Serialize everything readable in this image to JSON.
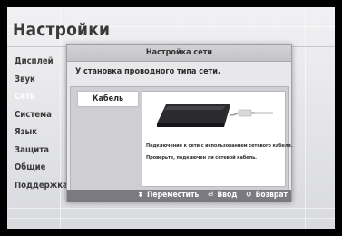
{
  "page": {
    "title": "Настройки"
  },
  "menu": {
    "items": [
      {
        "label": "Дисплей",
        "active": false
      },
      {
        "label": "Звук",
        "active": false
      },
      {
        "label": "Сеть",
        "active": true
      },
      {
        "label": "Система",
        "active": false
      },
      {
        "label": "Язык",
        "active": false
      },
      {
        "label": "Защита",
        "active": false
      },
      {
        "label": "Общие",
        "active": false
      },
      {
        "label": "Поддержка",
        "active": false
      }
    ]
  },
  "dialog": {
    "title": "Настройка сети",
    "message": "У становка проводного типа сети.",
    "option_label": "Кабель",
    "info_line1": "Подключение к сети с использованием сетевого кабеля.",
    "info_line2": "Проверьте, подключен ли сетевой кабель."
  },
  "footer": {
    "move_icon": "up-down-arrows-icon",
    "move_label": "Переместить",
    "enter_icon": "enter-icon",
    "enter_label": "Ввод",
    "back_icon": "return-icon",
    "back_label": "Возврат"
  },
  "colors": {
    "background": "#e6e6e9",
    "dialog_header": "#c8c8cc",
    "footer_bar": "#7a7a80",
    "active_menu_text": "#ffffff"
  }
}
